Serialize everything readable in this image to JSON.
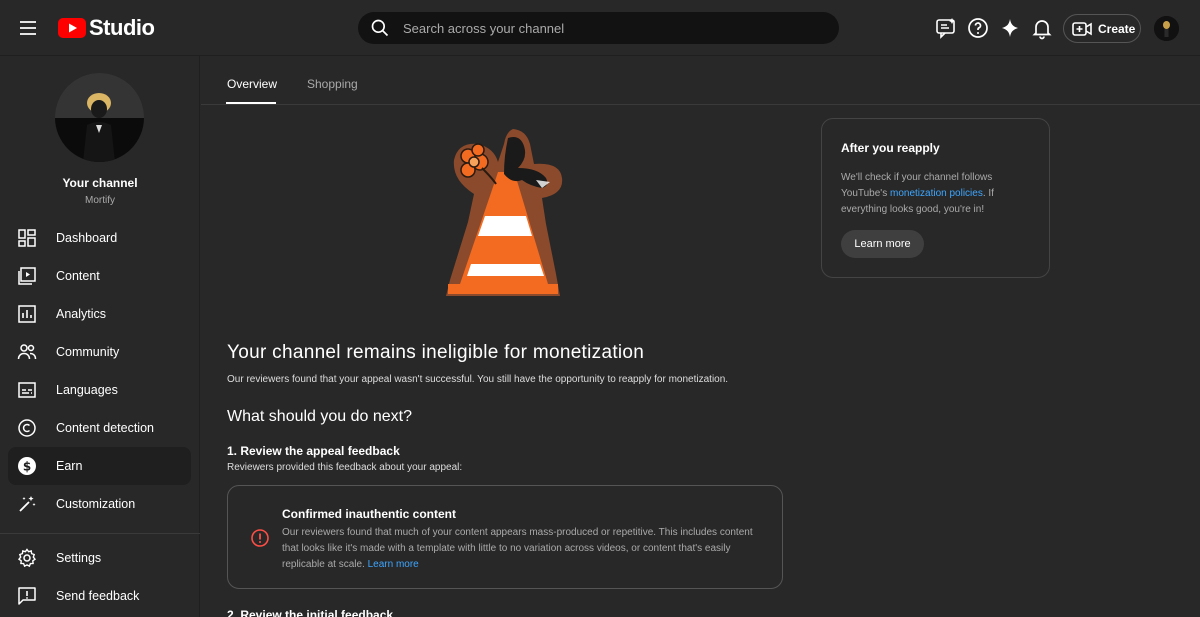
{
  "header": {
    "logo_text": "Studio",
    "search_placeholder": "Search across your channel",
    "create_label": "Create"
  },
  "sidebar": {
    "channel_title": "Your channel",
    "channel_name": "Mortify",
    "items": [
      {
        "label": "Dashboard",
        "icon": "dashboard-icon"
      },
      {
        "label": "Content",
        "icon": "content-icon"
      },
      {
        "label": "Analytics",
        "icon": "analytics-icon"
      },
      {
        "label": "Community",
        "icon": "community-icon"
      },
      {
        "label": "Languages",
        "icon": "languages-icon"
      },
      {
        "label": "Content detection",
        "icon": "copyright-icon"
      },
      {
        "label": "Earn",
        "icon": "dollar-icon",
        "active": true
      },
      {
        "label": "Customization",
        "icon": "magic-wand-icon"
      }
    ],
    "bottom_items": [
      {
        "label": "Settings",
        "icon": "gear-icon"
      },
      {
        "label": "Send feedback",
        "icon": "feedback-icon"
      }
    ]
  },
  "tabs": [
    {
      "label": "Overview",
      "active": true
    },
    {
      "label": "Shopping",
      "active": false
    }
  ],
  "main": {
    "heading": "Your channel remains ineligible for monetization",
    "intro": "Our reviewers found that your appeal wasn't successful. You still have the opportunity to reapply for monetization.",
    "next_heading": "What should you do next?",
    "step1_title": "1. Review the appeal feedback",
    "step1_sub": "Reviewers provided this feedback about your appeal:",
    "feedback_card": {
      "title": "Confirmed inauthentic content",
      "body": "Our reviewers found that much of your content appears mass-produced or repetitive. This includes content that looks like it's made with a template with little to no variation across videos, or content that's easily replicable at scale.",
      "link": "Learn more"
    },
    "step2_title": "2. Review the initial feedback"
  },
  "side_card": {
    "title": "After you reapply",
    "body_before": "We'll check if your channel follows YouTube's",
    "link": "monetization policies",
    "body_after": ". If everything looks good, you're in!",
    "button": "Learn more"
  },
  "colors": {
    "background": "#282828",
    "accent_link": "#3ea6ff",
    "brand_red": "#ff0000",
    "error_red": "#ff4e45",
    "cone_orange": "#f26b21"
  }
}
